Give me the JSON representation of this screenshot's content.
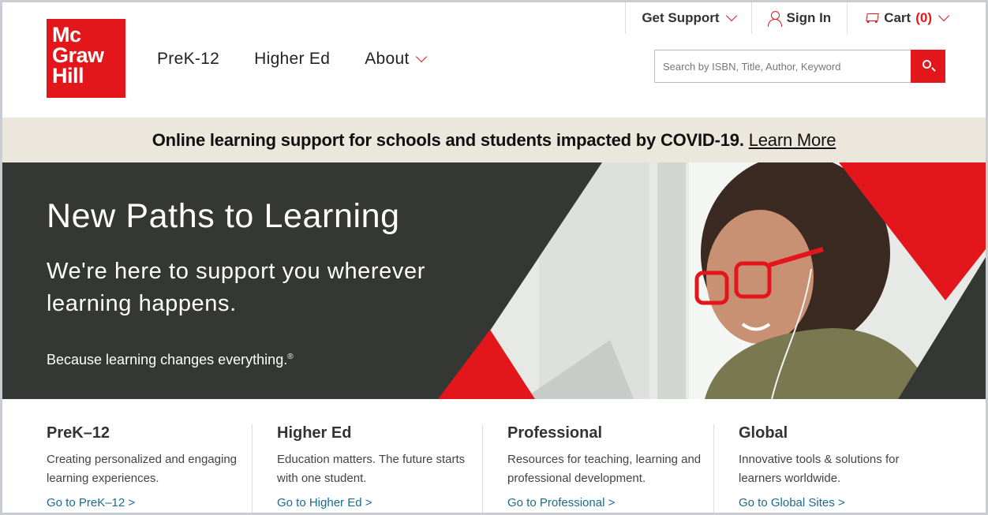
{
  "logo": {
    "line1": "Mc",
    "line2": "Graw",
    "line3": "Hill"
  },
  "nav": {
    "items": [
      {
        "label": "PreK-12"
      },
      {
        "label": "Higher Ed"
      },
      {
        "label": "About"
      }
    ]
  },
  "utility": {
    "support": "Get Support",
    "signin": "Sign In",
    "cart_label": "Cart",
    "cart_count": "(0)"
  },
  "search": {
    "placeholder": "Search by ISBN, Title, Author, Keyword"
  },
  "banner": {
    "text": "Online learning support for schools and students impacted by COVID-19.",
    "link": "Learn More"
  },
  "hero": {
    "title": "New Paths to Learning",
    "subtitle": "We're here to support you wherever learning happens.",
    "tagline": "Because learning changes everything.",
    "tagline_mark": "®"
  },
  "cards": [
    {
      "title": "PreK–12",
      "desc": "Creating personalized and engaging learning experiences.",
      "link": "Go to PreK–12 >"
    },
    {
      "title": "Higher Ed",
      "desc": "Education matters. The future starts with one student.",
      "link": "Go to Higher Ed >"
    },
    {
      "title": "Professional",
      "desc": "Resources for teaching, learning and professional development.",
      "link": "Go to Professional >"
    },
    {
      "title": "Global",
      "desc": "Innovative tools & solutions for learners worldwide.",
      "link": "Go to Global Sites >"
    }
  ],
  "colors": {
    "brand_red": "#e3161c",
    "hero_dark": "#353734",
    "banner_bg": "#ebe7dd",
    "link": "#1a6b8f"
  }
}
